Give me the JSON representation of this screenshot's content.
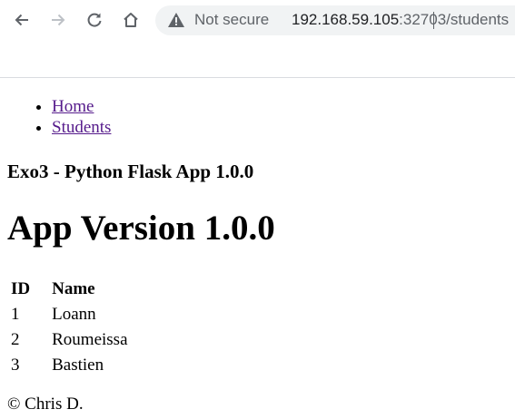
{
  "browser": {
    "security_label": "Not secure",
    "url_host": "192.168.59.105",
    "url_rest": ":32703/students",
    "colors": {
      "omnibox_bg": "#f1f3f4",
      "icon": "#5f6368",
      "forward_disabled": "#bdc1c6"
    }
  },
  "nav": {
    "items": [
      {
        "label": "Home"
      },
      {
        "label": "Students"
      }
    ]
  },
  "subtitle": "Exo3 - Python Flask App 1.0.0",
  "page_title": "App Version 1.0.0",
  "table": {
    "headers": {
      "id": "ID",
      "name": "Name"
    },
    "rows": [
      {
        "id": "1",
        "name": "Loann"
      },
      {
        "id": "2",
        "name": "Roumeissa"
      },
      {
        "id": "3",
        "name": "Bastien"
      }
    ]
  },
  "footer": "© Chris D.",
  "colors": {
    "link_visited": "#551a8b",
    "text": "#000000"
  }
}
